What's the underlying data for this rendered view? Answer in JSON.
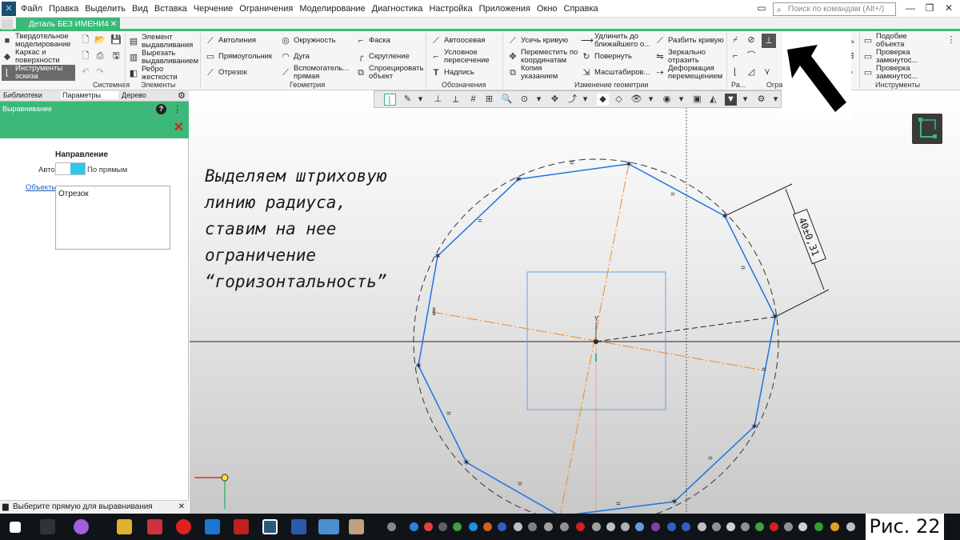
{
  "menu": [
    "Файл",
    "Правка",
    "Выделить",
    "Вид",
    "Вставка",
    "Черчение",
    "Ограничения",
    "Моделирование",
    "Диагностика",
    "Настройка",
    "Приложения",
    "Окно",
    "Справка"
  ],
  "search_placeholder": "Поиск по командам (Alt+/)",
  "doc_tab": "Деталь БЕЗ ИМЕНИ4",
  "modes": [
    "Твердотельное моделирование",
    "Каркас и поверхности",
    "Инструменты эскиза"
  ],
  "modes_display": [
    [
      "Твердотельное",
      "моделирование"
    ],
    [
      "Каркас и",
      "поверхности"
    ],
    [
      "Инструменты",
      "эскиза"
    ]
  ],
  "ribbon": {
    "elements": [
      [
        "Элемент",
        "выдавливания"
      ],
      [
        "Вырезать",
        "выдавливанием"
      ],
      [
        "Ребро",
        "жесткости"
      ]
    ],
    "geometry_col1": [
      "Автолиния",
      "Прямоугольник",
      "Отрезок"
    ],
    "geometry_col2": [
      "Окружность",
      "Дуга"
    ],
    "geometry_col2_multi": [
      "Вспомогатель...",
      "прямая"
    ],
    "geometry_col3": [
      "Фаска",
      "Скругление"
    ],
    "geometry_col3_multi": [
      "Спроецировать",
      "объект"
    ],
    "notation": [
      "Автоосевая",
      "Условное пересечение",
      "Надпись"
    ],
    "notation_multi": [
      "Условное",
      "пересечение"
    ],
    "edit_col1": [
      "Усечь кривую",
      "Переместить по координатам",
      "Копия указанием"
    ],
    "edit_col1_multi": [
      [
        "Переместить по",
        "координатам"
      ],
      [
        "Копия",
        "указанием"
      ]
    ],
    "edit_col2": [
      "Удлинить до ближайшего о...",
      "Повернуть",
      "Масштабиров..."
    ],
    "edit_col2_multi": [
      "Удлинить до",
      "ближайшего о..."
    ],
    "edit_col3": [
      "Разбить кривую",
      "Зеркально отразить",
      "Деформация перемещением"
    ],
    "edit_col3_multi": [
      [
        "Зеркально",
        "отразить"
      ],
      [
        "Деформация",
        "перемещением"
      ]
    ],
    "tools": [
      [
        "Подобие",
        "объекта"
      ],
      [
        "Проверка",
        "замкнутос..."
      ],
      [
        "Проверка",
        "замкнутос..."
      ]
    ]
  },
  "group_labels": {
    "system": "Системная",
    "elements": "Элементы",
    "geometry": "Геометрия",
    "notation": "Обозначения",
    "edit": "Изменение геометрии",
    "dim": "Ра...",
    "constraints": "Огра",
    "tools": "Инструменты"
  },
  "left_panel": {
    "tabs": [
      "Библиотеки",
      "Параметры",
      "Дерево"
    ],
    "header_title": "Выравнивание",
    "direction_title": "Направление",
    "auto_label": "Авто",
    "lines_label": "По прямым",
    "objects_link": "Объекты",
    "objects_value": "Отрезок"
  },
  "status_text": "Выберите прямую для выравнивания",
  "hint_lines": [
    "Выделяем штриховую",
    "линию радиуса,",
    "ставим на нее",
    "ограничение",
    "“горизонтальность”"
  ],
  "dimension_label": "40±0,31",
  "axis_label_y": "Y",
  "figure_label": "Рис. 22",
  "colors": {
    "accent_green": "#3cb878",
    "sketch_blue": "#1e73e8",
    "axis_orange": "#f08a24",
    "toggle_cyan": "#30c8e8"
  }
}
